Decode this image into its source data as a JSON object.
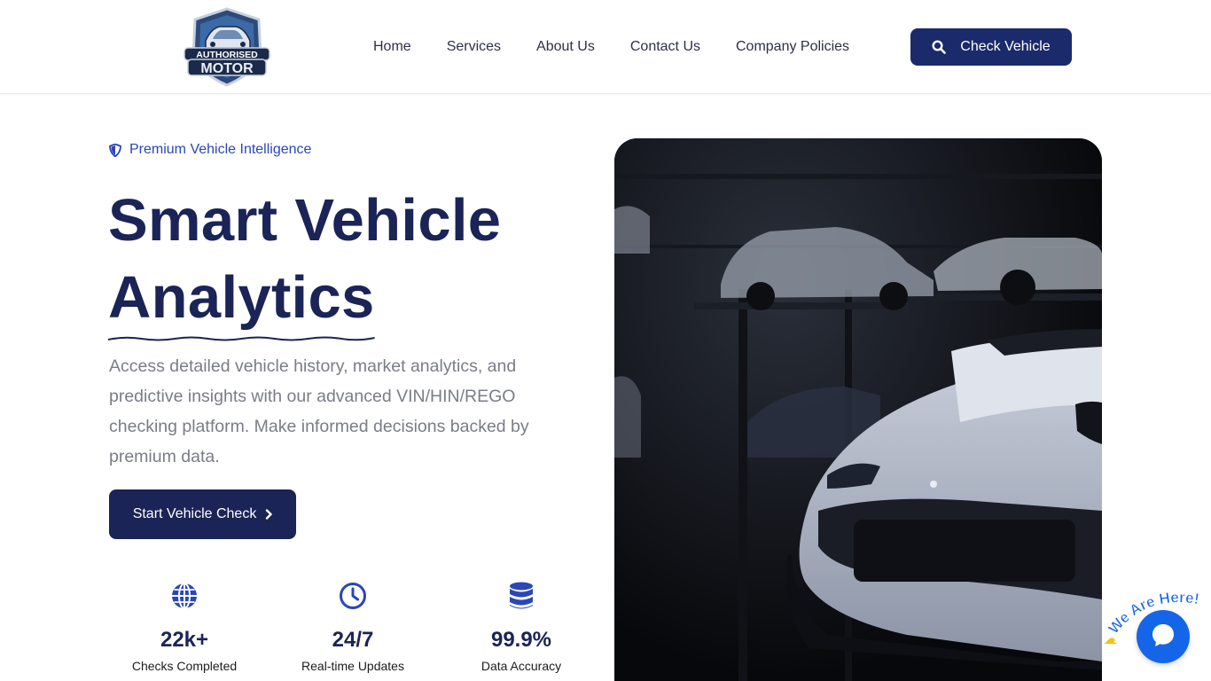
{
  "header": {
    "logo": {
      "line1": "AUTHORISED",
      "line2": "MOTOR",
      "icon": "shield-car-logo"
    },
    "nav": [
      "Home",
      "Services",
      "About Us",
      "Contact Us",
      "Company Policies"
    ],
    "cta": {
      "label": "Check Vehicle",
      "icon": "search-icon"
    }
  },
  "hero": {
    "tagline": {
      "icon": "shield-icon",
      "text": "Premium Vehicle Intelligence"
    },
    "title_line1": "Smart Vehicle",
    "title_line2": "Analytics",
    "description": "Access detailed vehicle history, market analytics, and predictive insights with our advanced VIN/HIN/REGO checking platform. Make informed decisions backed by premium data.",
    "button": {
      "label": "Start Vehicle Check",
      "icon": "chevron-right-icon"
    },
    "image": {
      "subject": "white sports car in dark garage"
    }
  },
  "stats": [
    {
      "icon": "globe-icon",
      "value": "22k+",
      "label": "Checks Completed"
    },
    {
      "icon": "clock-icon",
      "value": "24/7",
      "label": "Real-time Updates"
    },
    {
      "icon": "database-icon",
      "value": "99.9%",
      "label": "Data Accuracy"
    }
  ],
  "chat": {
    "text": "We Are Here!",
    "icon": "chat-bubble-icon"
  },
  "colors": {
    "brand_navy": "#1a2456",
    "accent_blue": "#2a46b8",
    "chat_blue": "#1565e8"
  }
}
